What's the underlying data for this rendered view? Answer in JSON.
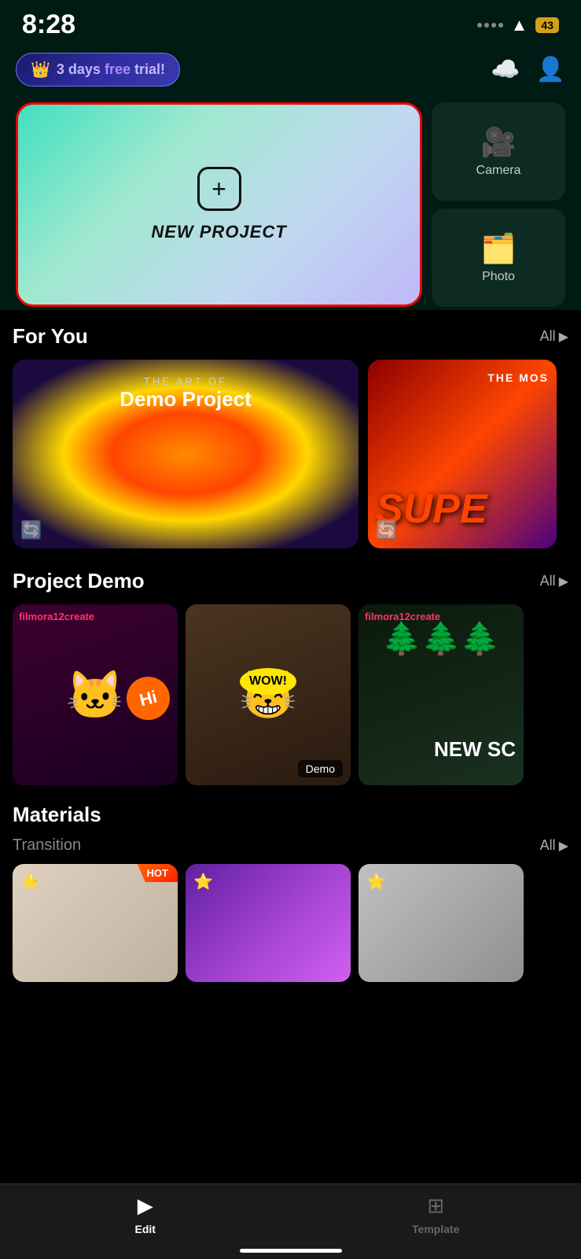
{
  "statusBar": {
    "time": "8:28",
    "battery": "43"
  },
  "header": {
    "trialBadge": "3 days free trial!",
    "trialFreeText": "free",
    "trialRestText": "3 days ",
    "trialEndText": "trial!"
  },
  "newProject": {
    "label": "NEW PROJECT"
  },
  "sideButtons": [
    {
      "label": "Camera",
      "icon": "🎥"
    },
    {
      "label": "Photo",
      "icon": "🗂️"
    }
  ],
  "forYou": {
    "sectionTitle": "For You",
    "allLabel": "All",
    "cards": [
      {
        "subtitle": "THE ART OF",
        "title": "Demo Project"
      },
      {
        "subtitle": "THE MOS",
        "title": "SUPE"
      }
    ]
  },
  "projectDemo": {
    "sectionTitle": "Project Demo",
    "allLabel": "All",
    "cards": [
      {
        "overlayText": "filmora12create",
        "tag": null,
        "type": "cat-white"
      },
      {
        "overlayText": null,
        "tag": "Demo",
        "type": "cat-grey"
      },
      {
        "overlayText": "filmora12create",
        "tag": null,
        "type": "cat-forest"
      }
    ]
  },
  "materials": {
    "sectionTitle": "Materials",
    "transition": {
      "title": "Transition",
      "allLabel": "All",
      "cards": [
        {
          "hot": true
        },
        {
          "hot": false
        },
        {
          "hot": false
        }
      ]
    }
  },
  "bottomNav": {
    "items": [
      {
        "label": "Edit",
        "active": true
      },
      {
        "label": "Template",
        "active": false
      }
    ]
  }
}
